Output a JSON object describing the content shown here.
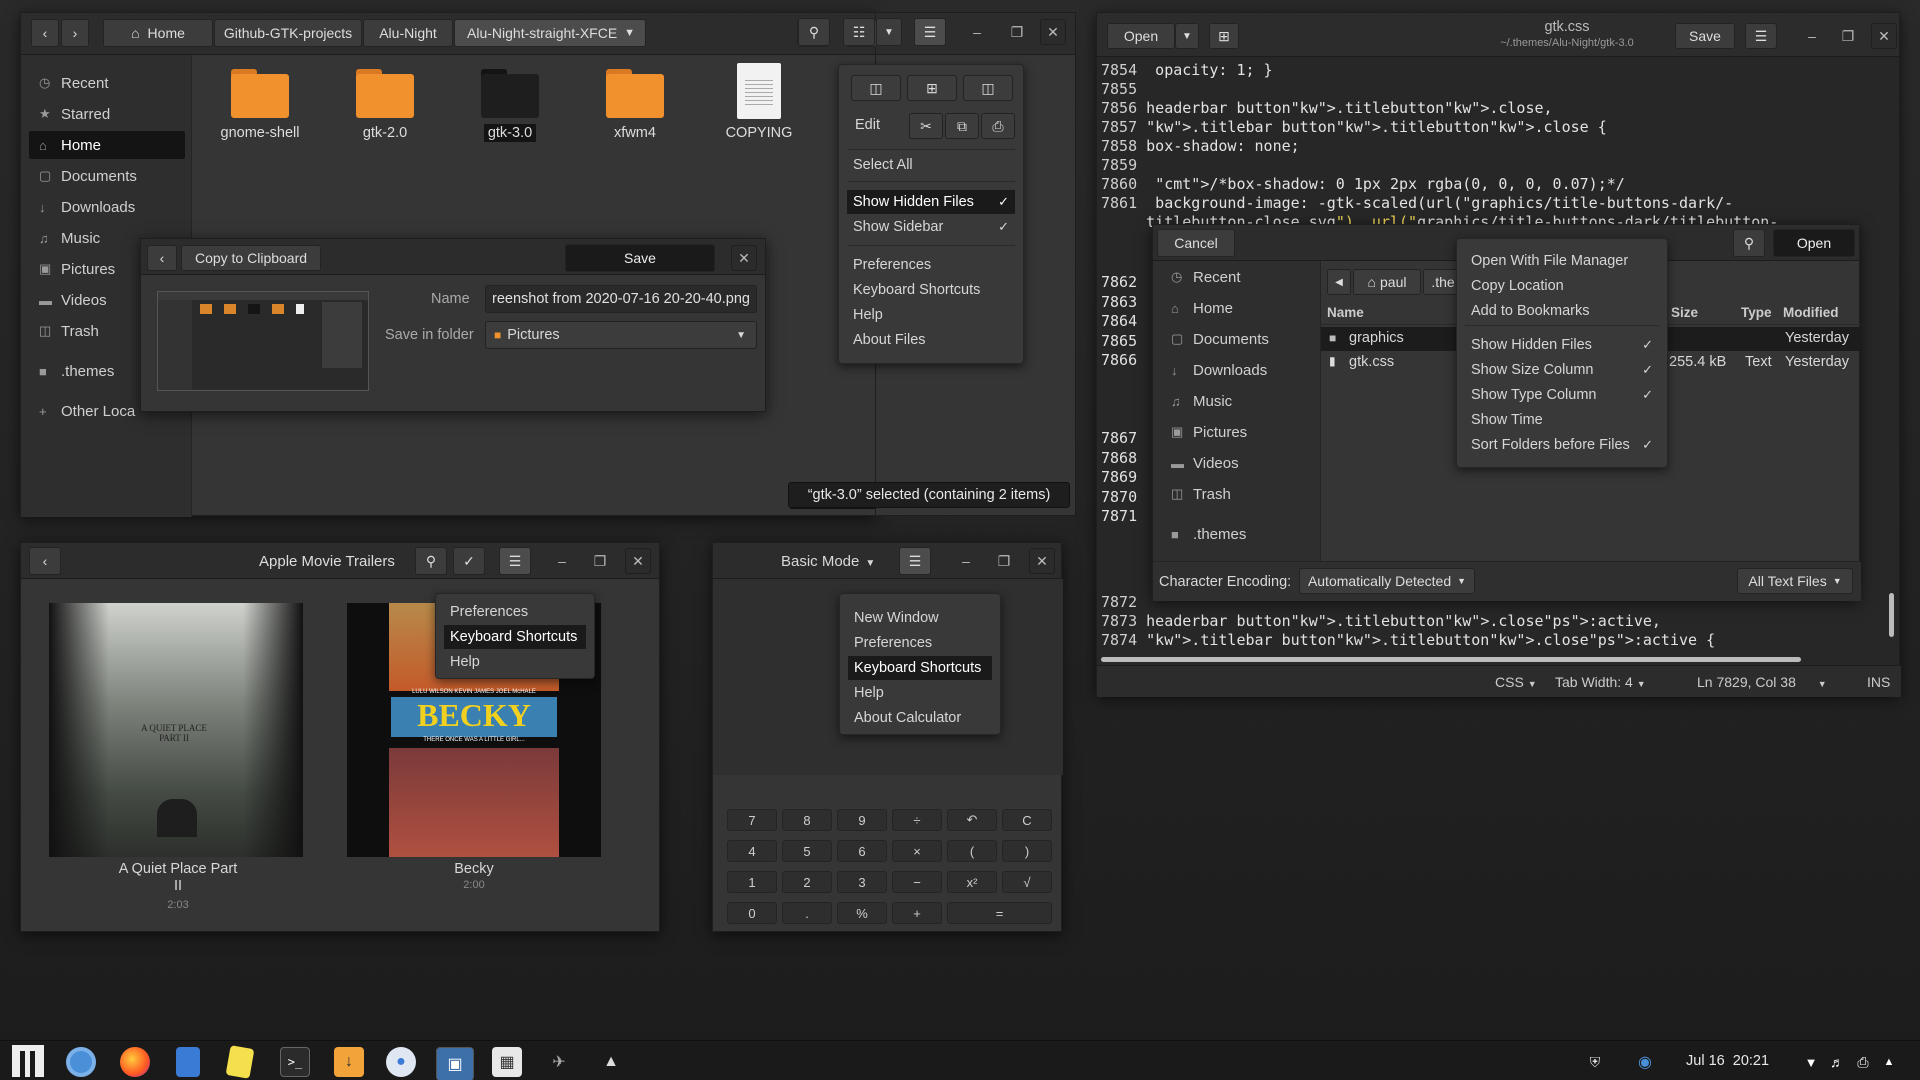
{
  "files_window": {
    "path": [
      "Home",
      "Github-GTK-projects",
      "Alu-Night",
      "Alu-Night-straight-XFCE"
    ],
    "sidebar": [
      "Recent",
      "Starred",
      "Home",
      "Documents",
      "Downloads",
      "Music",
      "Pictures",
      "Videos",
      "Trash",
      ".themes",
      "Other Loca"
    ],
    "sidebar_icons": [
      "clock-icon",
      "star-icon",
      "home-icon",
      "document-icon",
      "download-icon",
      "music-icon",
      "camera-icon",
      "video-icon",
      "trash-icon",
      "folder-icon",
      "plus-icon"
    ],
    "items": [
      {
        "name": "gnome-shell",
        "type": "folder"
      },
      {
        "name": "gtk-2.0",
        "type": "folder"
      },
      {
        "name": "gtk-3.0",
        "type": "folder-selected"
      },
      {
        "name": "xfwm4",
        "type": "folder"
      },
      {
        "name": "COPYING",
        "type": "file"
      }
    ],
    "status": "“gtk-3.0” selected (containing 2 items)",
    "menu": {
      "edit": "Edit",
      "items": [
        "Select All",
        "Show Hidden Files",
        "Show Sidebar",
        "Preferences",
        "Keyboard Shortcuts",
        "Help",
        "About Files"
      ]
    }
  },
  "screenshot_dialog": {
    "copy": "Copy to Clipboard",
    "save": "Save",
    "name_label": "Name",
    "name_value": "reenshot from 2020-07-16 20-20-40.png",
    "folder_label": "Save in folder",
    "folder_value": "Pictures"
  },
  "trailers": {
    "title": "Apple Movie Trailers",
    "menu": [
      "Preferences",
      "Keyboard Shortcuts",
      "Help"
    ],
    "movies": [
      {
        "title": "A Quiet Place Part II",
        "duration": "2:03"
      },
      {
        "title": "Becky",
        "duration": "2:00"
      }
    ],
    "poster_text": {
      "quiet": "A QUIET PLACE PART II",
      "becky": "BECKY",
      "becky_cast": "LULU WILSON   KEVIN JAMES   JOEL McHALE",
      "becky_tag": "THERE ONCE WAS A LITTLE GIRL..."
    }
  },
  "calculator": {
    "mode": "Basic Mode",
    "menu": [
      "New Window",
      "Preferences",
      "Keyboard Shortcuts",
      "Help",
      "About Calculator"
    ],
    "keys": [
      [
        "7",
        "8",
        "9",
        "÷",
        "↶",
        "C"
      ],
      [
        "4",
        "5",
        "6",
        "×",
        "(",
        ")"
      ],
      [
        "1",
        "2",
        "3",
        "−",
        "x²",
        "√"
      ],
      [
        "0",
        ".",
        "%",
        "+",
        "="
      ]
    ]
  },
  "editor": {
    "title": "gtk.css",
    "subtitle": "~/.themes/Alu-Night/gtk-3.0",
    "open": "Open",
    "save": "Save",
    "lines_top": [
      {
        "n": "7854",
        "t": " opacity: 1; }"
      },
      {
        "n": "7855",
        "t": ""
      },
      {
        "n": "7856",
        "t": "headerbar button.titlebutton.close,"
      },
      {
        "n": "7857",
        "t": ".titlebar button.titlebutton.close {"
      },
      {
        "n": "7858",
        "t": "box-shadow: none;"
      },
      {
        "n": "7859",
        "t": ""
      },
      {
        "n": "7860",
        "t": " /*box-shadow: 0 1px 2px rgba(0, 0, 0, 0.07);*/"
      },
      {
        "n": "7861",
        "t": " background-image: -gtk-scaled(url(\"graphics/title-buttons-dark/-"
      },
      {
        "n": "",
        "t": "titlebutton-close.svg\"), url(\"graphics/title-buttons-dark/titlebutton-"
      }
    ],
    "gutter_mid": [
      "7862",
      "7863",
      "7864",
      "7865",
      "7866",
      "",
      "",
      "",
      "7867",
      "7868",
      "7869",
      "7870",
      "7871"
    ],
    "lines_bottom": [
      {
        "n": "7872",
        "t": ""
      },
      {
        "n": "7873",
        "t": "headerbar button.titlebutton.close:active,"
      },
      {
        "n": "7874",
        "t": ".titlebar button.titlebutton.close:active {"
      }
    ],
    "status": {
      "lang": "CSS",
      "tab": "Tab Width: 4",
      "pos": "Ln 7829, Col 38",
      "ins": "INS"
    }
  },
  "open_dialog": {
    "cancel": "Cancel",
    "open": "Open",
    "path": [
      "paul",
      ".the"
    ],
    "sidebar": [
      "Recent",
      "Home",
      "Documents",
      "Downloads",
      "Music",
      "Pictures",
      "Videos",
      "Trash",
      ".themes"
    ],
    "sidebar_icons": [
      "clock-icon",
      "home-icon",
      "document-icon",
      "download-icon",
      "music-icon",
      "camera-icon",
      "video-icon",
      "trash-icon",
      "folder-icon"
    ],
    "columns": [
      "Name",
      "Size",
      "Type",
      "Modified"
    ],
    "rows": [
      {
        "name": "graphics",
        "size": "",
        "type": "",
        "modified": "Yesterday"
      },
      {
        "name": "gtk.css",
        "size": "255.4 kB",
        "type": "Text",
        "modified": "Yesterday"
      }
    ],
    "encoding_label": "Character Encoding:",
    "encoding": "Automatically Detected",
    "filter": "All Text Files",
    "context_menu": [
      {
        "label": "Open With File Manager",
        "checked": false
      },
      {
        "label": "Copy Location",
        "checked": false
      },
      {
        "label": "Add to Bookmarks",
        "checked": false
      },
      {
        "label": "Show Hidden Files",
        "checked": true
      },
      {
        "label": "Show Size Column",
        "checked": true
      },
      {
        "label": "Show Type Column",
        "checked": true
      },
      {
        "label": "Show Time",
        "checked": false
      },
      {
        "label": "Sort Folders before Files",
        "checked": true
      }
    ]
  },
  "taskbar": {
    "clock": "Jul 16  20:21"
  },
  "colors": {
    "folder": "#f0912e",
    "accent": "#141414"
  }
}
